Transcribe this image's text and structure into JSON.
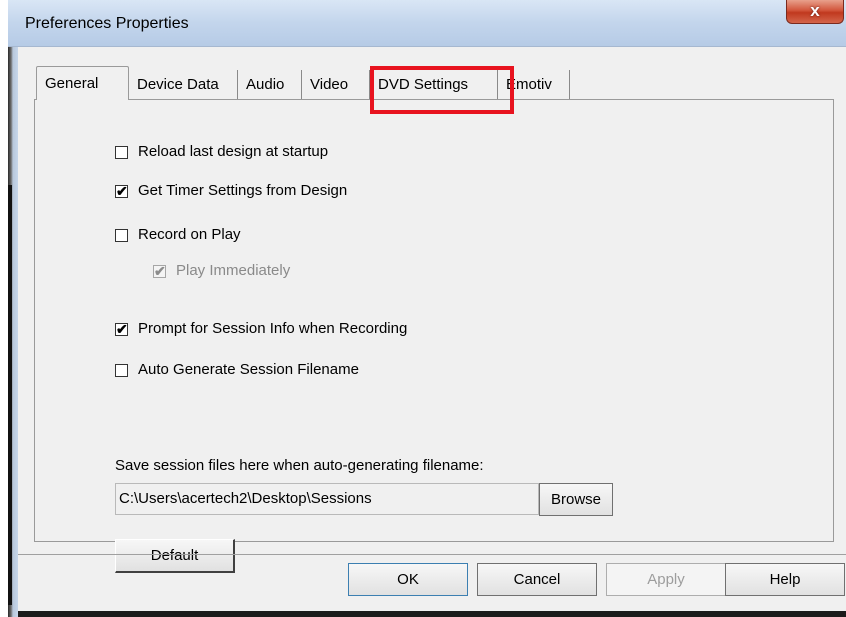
{
  "window": {
    "title": "Preferences Properties",
    "close_glyph": "x"
  },
  "tabs": [
    {
      "label": "General",
      "active": true
    },
    {
      "label": "Device Data"
    },
    {
      "label": "Audio"
    },
    {
      "label": "Video"
    },
    {
      "label": "DVD Settings",
      "highlighted": true
    },
    {
      "label": "Emotiv"
    }
  ],
  "options": {
    "reload_last_design": {
      "label": "Reload last design at startup",
      "checked": false
    },
    "get_timer_settings": {
      "label": "Get Timer Settings from Design",
      "checked": true
    },
    "record_on_play": {
      "label": "Record on Play",
      "checked": false
    },
    "play_immediately": {
      "label": "Play Immediately",
      "checked": true,
      "disabled": true
    },
    "prompt_session_info": {
      "label": "Prompt for Session Info when Recording",
      "checked": true
    },
    "auto_generate_filename": {
      "label": "Auto Generate Session Filename",
      "checked": false
    }
  },
  "session_path": {
    "label": "Save session files here when auto-generating filename:",
    "value": "C:\\Users\\acertech2\\Desktop\\Sessions",
    "browse_label": "Browse"
  },
  "default_label": "Default",
  "footer": {
    "ok": "OK",
    "cancel": "Cancel",
    "apply": "Apply",
    "help": "Help"
  },
  "colors": {
    "highlight_box": "#e8131f",
    "title_gradient": "#c3d5ec",
    "close_button": "#c0391f"
  },
  "check_glyph": "✔"
}
